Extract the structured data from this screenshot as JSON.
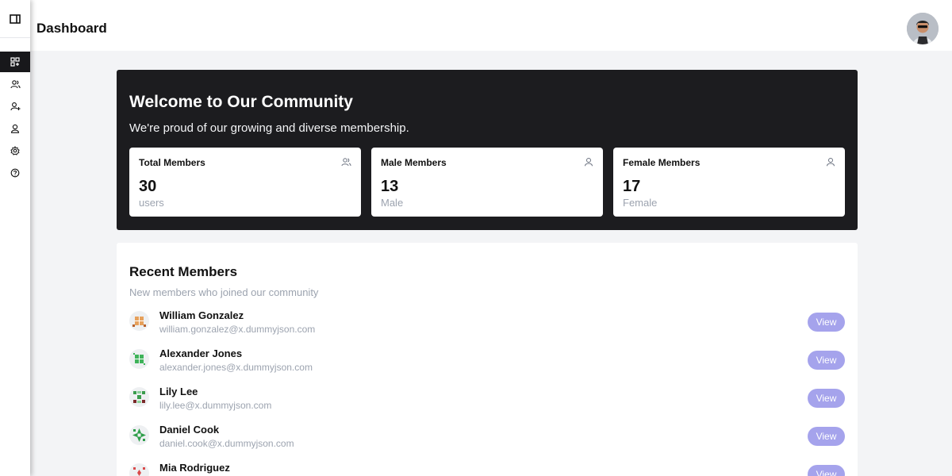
{
  "header": {
    "title": "Dashboard"
  },
  "sidebar": {
    "items": [
      {
        "icon": "dashboard-icon",
        "active": true
      },
      {
        "icon": "users-icon",
        "active": false
      },
      {
        "icon": "user-plus-icon",
        "active": false
      },
      {
        "icon": "user-icon",
        "active": false
      },
      {
        "icon": "gear-icon",
        "active": false
      },
      {
        "icon": "help-icon",
        "active": false
      }
    ]
  },
  "hero": {
    "title": "Welcome to Our Community",
    "subtitle": "We're proud of our growing and diverse membership.",
    "stats": [
      {
        "label": "Total Members",
        "value": "30",
        "unit": "users",
        "icon": "users-icon"
      },
      {
        "label": "Male Members",
        "value": "13",
        "unit": "Male",
        "icon": "user-icon"
      },
      {
        "label": "Female Members",
        "value": "17",
        "unit": "Female",
        "icon": "user-icon"
      }
    ]
  },
  "recent": {
    "title": "Recent Members",
    "subtitle": "New members who joined our community",
    "view_label": "View",
    "members": [
      {
        "name": "William Gonzalez",
        "email": "william.gonzalez@x.dummyjson.com",
        "avatar_color": "#e6a15c"
      },
      {
        "name": "Alexander Jones",
        "email": "alexander.jones@x.dummyjson.com",
        "avatar_color": "#3fb35a"
      },
      {
        "name": "Lily Lee",
        "email": "lily.lee@x.dummyjson.com",
        "avatar_color": "#3a9c4c"
      },
      {
        "name": "Daniel Cook",
        "email": "daniel.cook@x.dummyjson.com",
        "avatar_color": "#2e9e4a"
      },
      {
        "name": "Mia Rodriguez",
        "email": "",
        "avatar_color": "#d94a4a"
      }
    ]
  },
  "colors": {
    "accent": "#a5a3ec",
    "hero_bg": "#1c1c1f",
    "page_bg": "#f3f4f6"
  }
}
